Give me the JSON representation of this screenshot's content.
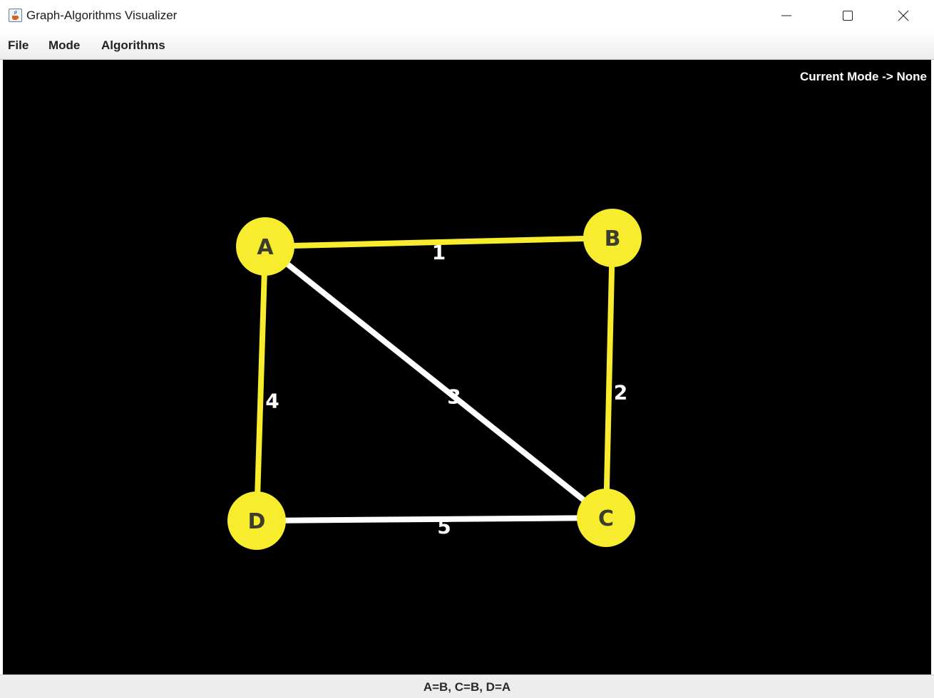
{
  "window": {
    "title": "Graph-Algorithms Visualizer",
    "controls": {
      "minimize": "minimize-icon",
      "maximize": "maximize-icon",
      "close": "close-icon"
    }
  },
  "menu": {
    "items": [
      {
        "label": "File"
      },
      {
        "label": "Mode"
      },
      {
        "label": "Algorithms"
      }
    ]
  },
  "canvas": {
    "mode_label": "Current Mode -> None",
    "background": "#000000"
  },
  "graph": {
    "colors": {
      "node": "#f7ec2d",
      "node_label": "#3d3d2e",
      "highlight_edge": "#f7ec2d",
      "default_edge": "#ffffff",
      "weight_label": "#ffffff"
    },
    "nodes": [
      {
        "id": "A",
        "label": "A"
      },
      {
        "id": "B",
        "label": "B"
      },
      {
        "id": "C",
        "label": "C"
      },
      {
        "id": "D",
        "label": "D"
      }
    ],
    "edges": [
      {
        "from": "A",
        "to": "B",
        "weight": "1",
        "highlighted": true
      },
      {
        "from": "B",
        "to": "C",
        "weight": "2",
        "highlighted": true
      },
      {
        "from": "A",
        "to": "C",
        "weight": "3",
        "highlighted": false
      },
      {
        "from": "A",
        "to": "D",
        "weight": "4",
        "highlighted": true
      },
      {
        "from": "D",
        "to": "C",
        "weight": "5",
        "highlighted": false
      }
    ]
  },
  "status": {
    "text": "A=B, C=B, D=A"
  }
}
